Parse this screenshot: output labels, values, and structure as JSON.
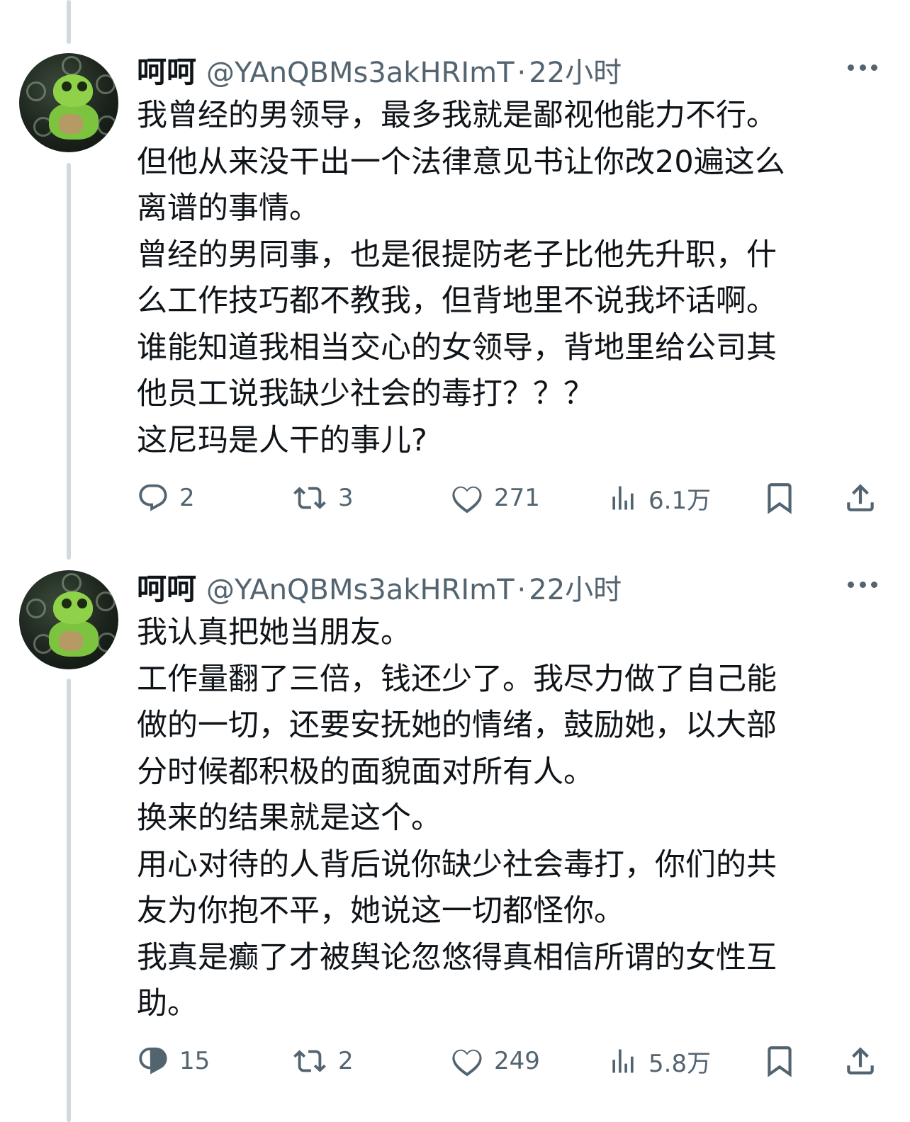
{
  "tweets": [
    {
      "display_name": "呵呵",
      "handle": "@YAnQBMs3akHRImT",
      "separator": "·",
      "time": "22小时",
      "lines": [
        "我曾经的男领导，最多我就是鄙视他能力不行。",
        "但他从来没干出一个法律意见书让你改20遍这么",
        "离谱的事情。",
        "曾经的男同事，也是很提防老子比他先升职，什",
        "么工作技巧都不教我，但背地里不说我坏话啊。",
        "谁能知道我相当交心的女领导，背地里给公司其",
        "他员工说我缺少社会的毒打？？？",
        "这尼玛是人干的事儿?"
      ],
      "replies": "2",
      "reposts": "3",
      "likes": "271",
      "views": "6.1万"
    },
    {
      "display_name": "呵呵",
      "handle": "@YAnQBMs3akHRImT",
      "separator": "·",
      "time": "22小时",
      "lines": [
        "我认真把她当朋友。",
        "工作量翻了三倍，钱还少了。我尽力做了自己能",
        "做的一切，还要安抚她的情绪，鼓励她，以大部",
        "分时候都积极的面貌面对所有人。",
        "换来的结果就是这个。",
        "用心对待的人背后说你缺少社会毒打，你们的共",
        "友为你抱不平，她说这一切都怪你。",
        "我真是癫了才被舆论忽悠得真相信所谓的女性互",
        "助。"
      ],
      "replies": "15",
      "reposts": "2",
      "likes": "249",
      "views": "5.8万"
    }
  ],
  "icons": {
    "reply": "reply-icon",
    "repost": "repost-icon",
    "like": "heart-icon",
    "views": "views-icon",
    "bookmark": "bookmark-icon",
    "share": "share-icon",
    "more": "more-icon"
  },
  "colors": {
    "text": "#0f1419",
    "secondary": "#536471",
    "thread_line": "#cfd9de"
  }
}
